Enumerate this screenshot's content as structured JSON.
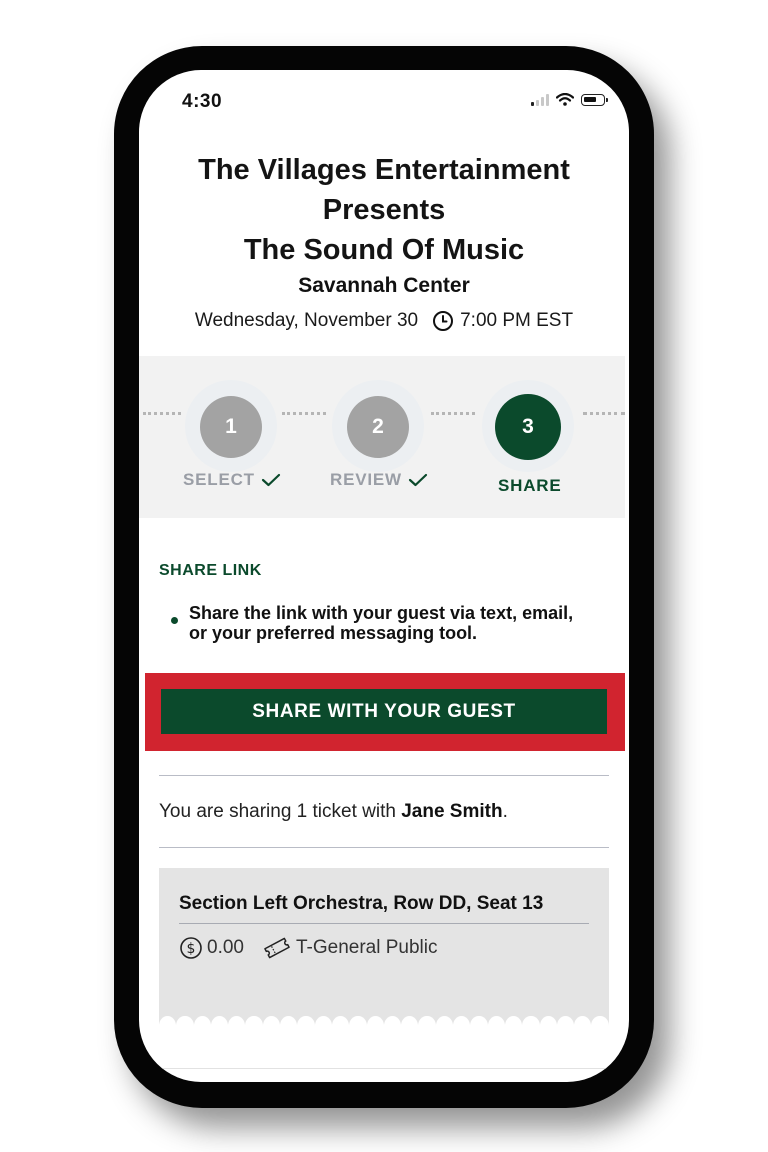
{
  "status_bar": {
    "time": "4:30"
  },
  "event": {
    "title_line1": "The Villages Entertainment",
    "title_line2": "Presents",
    "title_line3": "The Sound Of Music",
    "venue": "Savannah Center",
    "date": "Wednesday, November 30",
    "time": "7:00 PM EST"
  },
  "stepper": {
    "steps": [
      {
        "number": "1",
        "label": "SELECT",
        "state": "complete"
      },
      {
        "number": "2",
        "label": "REVIEW",
        "state": "complete"
      },
      {
        "number": "3",
        "label": "SHARE",
        "state": "active"
      }
    ]
  },
  "share": {
    "heading": "SHARE LINK",
    "instruction": "Share the link with your guest via text, email, or your preferred messaging tool.",
    "button_label": "SHARE WITH YOUR GUEST",
    "sharing_prefix": "You are sharing 1 ticket with ",
    "guest_name": "Jane Smith",
    "sharing_suffix": "."
  },
  "ticket": {
    "seat": "Section Left Orchestra, Row DD, Seat 13",
    "price": "0.00",
    "price_type": "T-General Public"
  },
  "colors": {
    "brand_green": "#0b4a2c",
    "highlight_red": "#d1242f",
    "step_complete_grey": "#a3a3a3"
  },
  "icons": [
    "signal-icon",
    "wifi-icon",
    "battery-icon",
    "clock-icon",
    "checkmark-icon",
    "dollar-circle-icon",
    "ticket-icon"
  ]
}
